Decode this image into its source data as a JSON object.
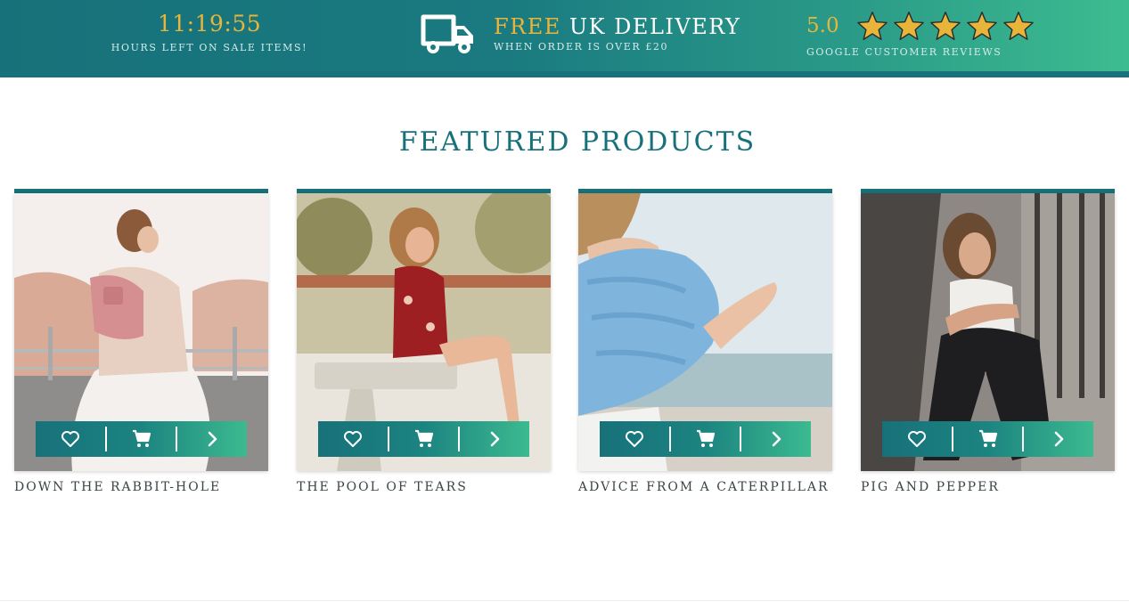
{
  "topbar": {
    "countdown": "11:19:55",
    "sale_caption": "HOURS LEFT ON SALE ITEMS!",
    "delivery_free": "FREE",
    "delivery_rest": " UK DELIVERY",
    "delivery_caption": "WHEN ORDER IS OVER £20",
    "rating": "5.0",
    "stars": 5,
    "reviews_caption": "GOOGLE CUSTOMER REVIEWS",
    "truck_icon": "truck-icon",
    "star_icon": "star-icon"
  },
  "featured": {
    "heading": "FEATURED PRODUCTS",
    "products": [
      {
        "title": "DOWN THE RABBIT-HOLE"
      },
      {
        "title": "THE POOL OF TEARS"
      },
      {
        "title": "ADVICE FROM A CATERPILLAR"
      },
      {
        "title": "PIG AND PEPPER"
      }
    ],
    "action_icons": [
      "heart-icon",
      "cart-icon",
      "chevron-right-icon"
    ]
  },
  "colors": {
    "teal": "#17717a",
    "gold": "#e8b53a",
    "green": "#3dbc90"
  }
}
